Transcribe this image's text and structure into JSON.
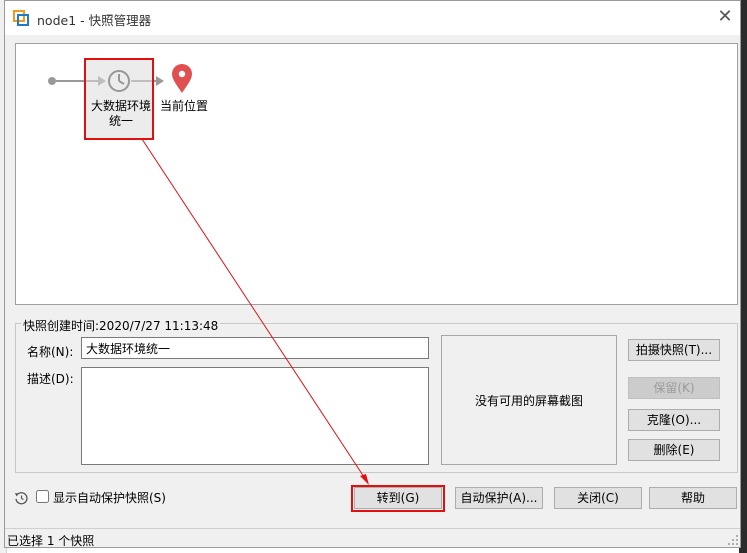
{
  "window": {
    "title": "node1 - 快照管理器",
    "close_label": "✕"
  },
  "flow": {
    "snapshot_label": "大数据环境统一",
    "current_label": "当前位置"
  },
  "details": {
    "created_time": "快照创建时间:2020/7/27 11:13:48",
    "name_label": "名称(N):",
    "name_value": "大数据环境统一",
    "desc_label": "描述(D):",
    "desc_value": "",
    "no_screenshot": "没有可用的屏幕截图"
  },
  "side_buttons": {
    "take": "拍摄快照(T)...",
    "keep": "保留(K)",
    "clone": "克隆(O)...",
    "delete": "删除(E)"
  },
  "bottom": {
    "show_auto_label": "显示自动保护快照(S)",
    "goto": "转到(G)",
    "autoprotect": "自动保护(A)...",
    "close": "关闭(C)",
    "help": "帮助"
  },
  "status": {
    "text": "已选择 1 个快照"
  },
  "colors": {
    "accent_red": "#e01010",
    "pin_red": "#e05050",
    "vmware_orange": "#f39a1e"
  }
}
